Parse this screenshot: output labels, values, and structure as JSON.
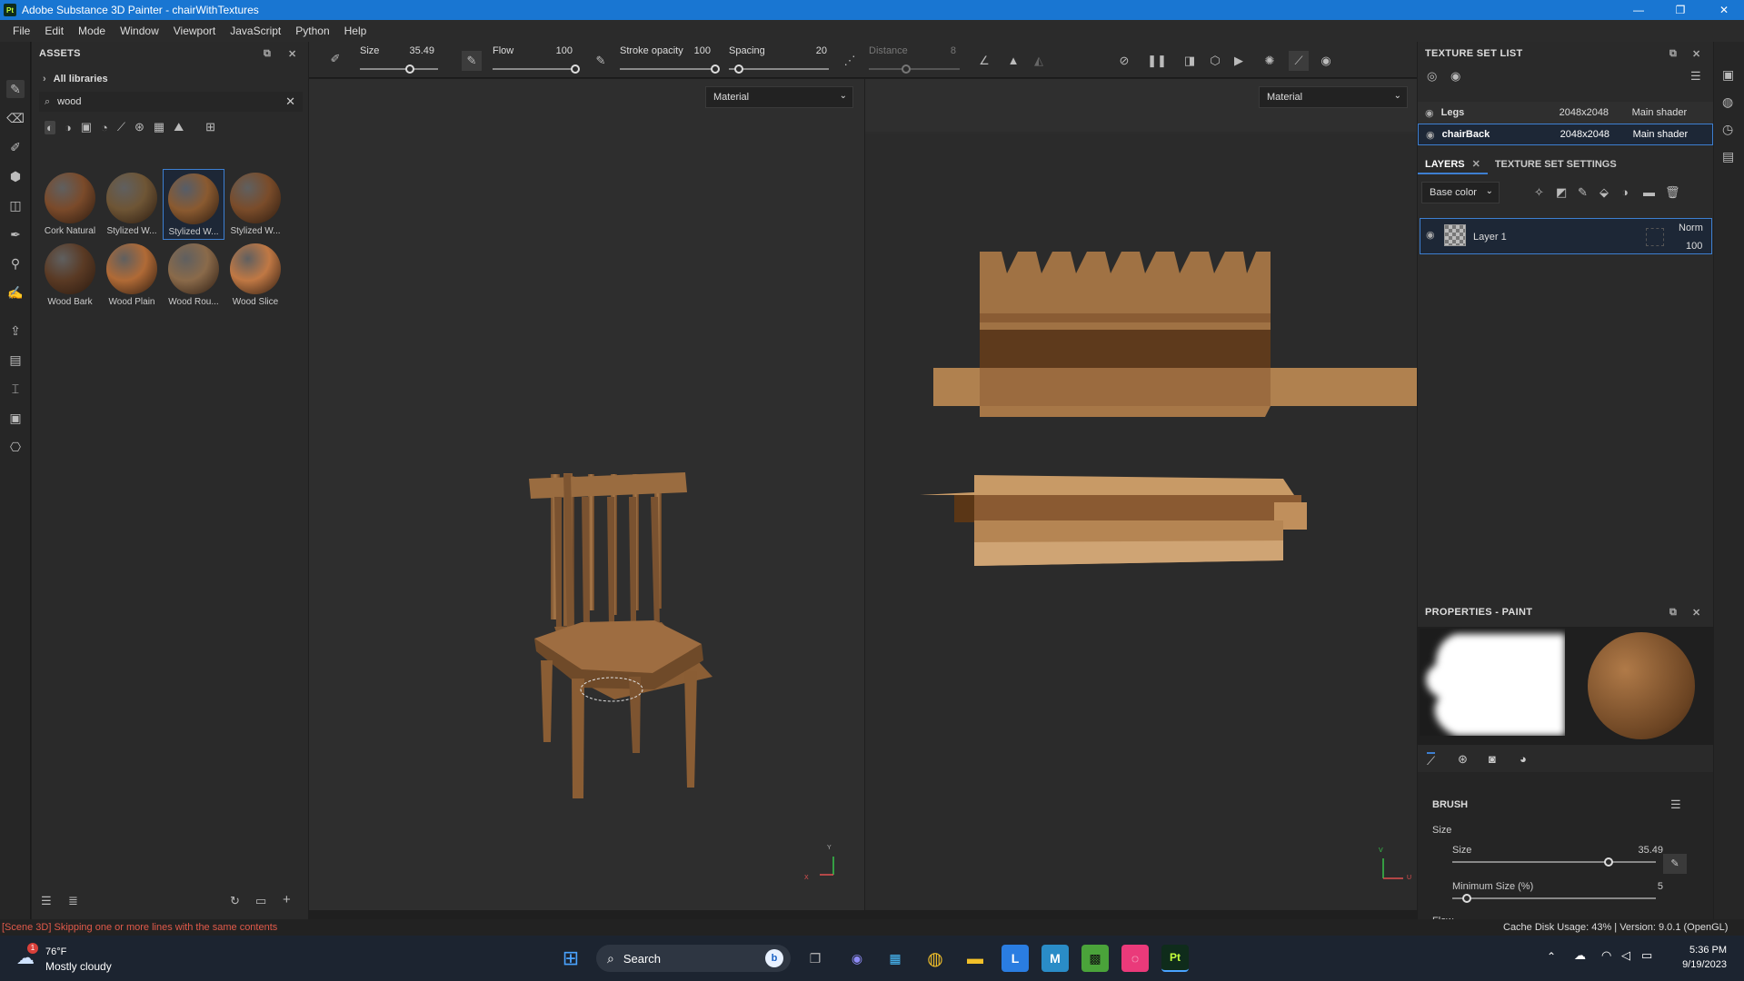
{
  "window": {
    "title": "Adobe Substance 3D Painter - chairWithTextures",
    "logo": "Pt"
  },
  "menu": [
    "File",
    "Edit",
    "Mode",
    "Window",
    "Viewport",
    "JavaScript",
    "Python",
    "Help"
  ],
  "assets": {
    "title": "ASSETS",
    "breadcrumb": "All libraries",
    "search_value": "wood",
    "materials": [
      {
        "label": "Cork Natural",
        "color": "#7a4a2a"
      },
      {
        "label": "Stylized W...",
        "color": "#6e5535"
      },
      {
        "label": "Stylized W...",
        "color": "#8a5a30"
      },
      {
        "label": "Stylized W...",
        "color": "#7a4c2a"
      },
      {
        "label": "Wood Bark",
        "color": "#5a3a24"
      },
      {
        "label": "Wood Plain",
        "color": "#b06a36"
      },
      {
        "label": "Wood Rou...",
        "color": "#8a6a4a"
      },
      {
        "label": "Wood Slice",
        "color": "#c07844"
      }
    ]
  },
  "toolbar": {
    "size_label": "Size",
    "size_value": "35.49",
    "flow_label": "Flow",
    "flow_value": "100",
    "stroke_label": "Stroke opacity",
    "stroke_value": "100",
    "spacing_label": "Spacing",
    "spacing_value": "20",
    "distance_label": "Distance",
    "distance_value": "8"
  },
  "viewport3d": {
    "mode": "Material"
  },
  "viewport2d": {
    "mode": "Material"
  },
  "texture_set_list": {
    "title": "TEXTURE SET LIST",
    "rows": [
      {
        "name": "Legs",
        "res": "2048x2048",
        "shader": "Main shader"
      },
      {
        "name": "chairBack",
        "res": "2048x2048",
        "shader": "Main shader"
      }
    ]
  },
  "layers": {
    "tab_layers": "LAYERS",
    "tab_settings": "TEXTURE SET SETTINGS",
    "channel": "Base color",
    "layer_name": "Layer 1",
    "blend": "Norm",
    "opacity": "100"
  },
  "properties": {
    "title": "PROPERTIES - PAINT",
    "section": "BRUSH",
    "group_size": "Size",
    "size_label": "Size",
    "size_value": "35.49",
    "size_fraction": 0.78,
    "minsize_label": "Minimum Size (%)",
    "minsize_value": "5",
    "minsize_fraction": 0.05,
    "flow_label": "Flow"
  },
  "status": {
    "message": "[Scene 3D] Skipping one or more lines with the same contents",
    "cache": "Cache Disk Usage:   43% | Version: 9.0.1 (OpenGL)"
  },
  "taskbar": {
    "weather_temp": "76°F",
    "weather_desc": "Mostly cloudy",
    "weather_badge": "1",
    "search": "Search",
    "time": "5:36 PM",
    "date": "9/19/2023"
  }
}
